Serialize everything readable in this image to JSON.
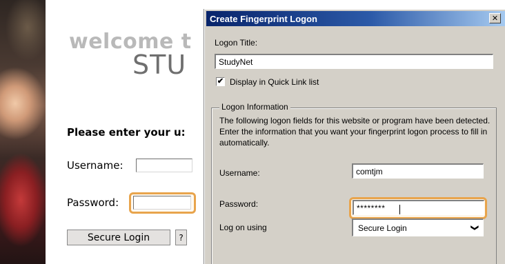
{
  "webpage": {
    "welcome_text": "welcome t",
    "site_name": "STU",
    "prompt": "Please enter your u:",
    "username_label": "Username:",
    "password_label": "Password:",
    "login_button": "Secure Login",
    "help_button": "?"
  },
  "dialog": {
    "title": "Create Fingerprint Logon",
    "close_glyph": "✕",
    "logon_title_label": "Logon Title:",
    "logon_title_value": "StudyNet",
    "quicklink_checked": true,
    "quicklink_check_glyph": "✔",
    "quicklink_label": "Display in Quick Link list",
    "group_label": "Logon Information",
    "info_text": "The following logon fields for this website or program have been detected. Enter the information that you want your fingerprint logon process to fill in automatically.",
    "username_label": "Username:",
    "username_value": "comtjm",
    "password_label": "Password:",
    "password_value": "********",
    "logon_using_label": "Log on using",
    "logon_using_value": "Secure Login",
    "dropdown_glyph": "❯"
  },
  "colors": {
    "titlebar_start": "#08246b",
    "titlebar_end": "#a6caf0",
    "dialog_face": "#d4d0c8",
    "focus_highlight": "#e8a44c"
  }
}
